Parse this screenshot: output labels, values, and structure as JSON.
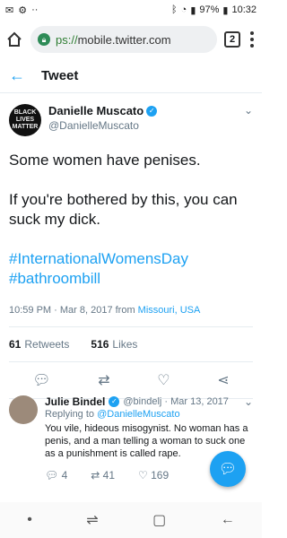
{
  "status": {
    "battery": "97%",
    "time": "10:32"
  },
  "browser": {
    "url_secure": "ps://",
    "url_rest": "mobile.twitter.com",
    "tab_count": "2"
  },
  "header": {
    "title": "Tweet"
  },
  "tweet": {
    "display_name": "Danielle Muscato",
    "handle": "@DanielleMuscato",
    "avatar_text": "BLACK LIVES MATTER",
    "line1": "Some women have penises.",
    "line2": "If you're bothered by this, you can suck my dick.",
    "hashtag1": "#InternationalWomensDay",
    "hashtag2": "#bathroombill",
    "time": "10:59 PM · Mar 8, 2017 from ",
    "location": "Missouri, USA",
    "retweets": "61",
    "retweets_label": "Retweets",
    "likes": "516",
    "likes_label": "Likes"
  },
  "reply": {
    "name": "Julie Bindel",
    "handle_date": "@bindelj · Mar 13, 2017",
    "replying_prefix": "Replying to ",
    "replying_to": "@DanielleMuscato",
    "text": "You vile, hideous misogynist. No woman has a penis, and a man telling a woman to suck one as a punishment is called rape.",
    "replies": "4",
    "retweets": "41",
    "likes": "169"
  },
  "colors": {
    "accent": "#1da1f2",
    "muted": "#657786"
  }
}
